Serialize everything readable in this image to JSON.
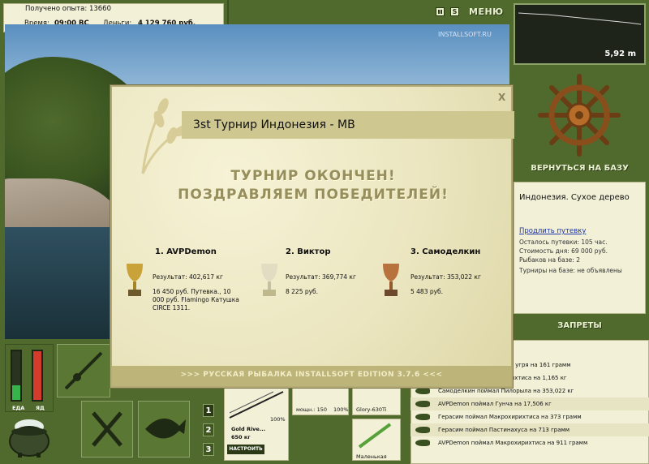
{
  "info": {
    "xp": "Получено опыта: 13660",
    "time_label": "Время:",
    "time_value": "09:00 ВС",
    "money_label": "Деньги:",
    "money_value": "4 129 760 руб."
  },
  "topbar": {
    "menu_label": "МЕНЮ",
    "sound_glyph": "S"
  },
  "watermark": "INSTALLSOFT.RU",
  "depth": {
    "value": "5,92 m"
  },
  "back_to_base": "ВЕРНУТЬСЯ НА БАЗУ",
  "location": {
    "title": "Индонезия. Сухое дерево",
    "extend_link": "Продлить путевку",
    "remaining": "Осталось путевки: 105 час.",
    "day_cost": "Стоимость дня: 69 000 руб.",
    "fishers": "Рыбаков на базе: 2",
    "tournaments": "Турниры на базе: не объявлены"
  },
  "bans_label": "ЗАПРЕТЫ",
  "meters": {
    "food_label": "ЕДА",
    "venom_label": "ЯД",
    "food_level": 0.3,
    "venom_level": 1.0
  },
  "slots": [
    "1",
    "2",
    "3"
  ],
  "inventory": {
    "rod_name": "Gold Rive...",
    "rod_weight": "650 кг",
    "set_button": "НАСТРОИТЬ",
    "pct1": "100%",
    "pct2": "100%",
    "power": "мощн.: 150",
    "reel": "Glory-630Ti",
    "small": "Маленькая"
  },
  "news": [
    "...ого угря на 161 грамм",
    "...ирихтиса на 1,165 кг",
    "Самоделкин поймал Пилорыла на 353,022 кг",
    "AVPDemon поймал Гунча на 17,506 кг",
    "Герасим поймал Макрохирихтиса на 373 грамм",
    "Герасим поймал Пастинахуса на 713 грамм",
    "AVPDemon поймал Макрохирихтиса на 911 грамм"
  ],
  "modal": {
    "close": "X",
    "title": "3st Турнир Индонезия - MB",
    "congrats_line1": "ТУРНИР ОКОНЧЕН!",
    "congrats_line2": "ПОЗДРАВЛЯЕМ ПОБЕДИТЕЛЕЙ!",
    "winners": [
      {
        "name": "1. AVPDemon",
        "result": "Результат: 402,617 кг",
        "prize": "16 450 руб. Путевка., 10 000 руб. Flamingo Катушка CIRCE 1311."
      },
      {
        "name": "2. Виктор",
        "result": "Результат: 369,774 кг",
        "prize": "8 225 руб."
      },
      {
        "name": "3. Самоделкин",
        "result": "Результат: 353,022 кг",
        "prize": "5 483 руб."
      }
    ],
    "footer": ">>> РУССКАЯ РЫБАЛКА INSTALLSOFT EDITION 3.7.6 <<<"
  },
  "colors": {
    "frame_green": "#4f6a2c",
    "panel_cream": "#f2f0d6",
    "gold": "#c9a23a",
    "silver": "#d8d4bf",
    "bronze": "#b8723e"
  }
}
